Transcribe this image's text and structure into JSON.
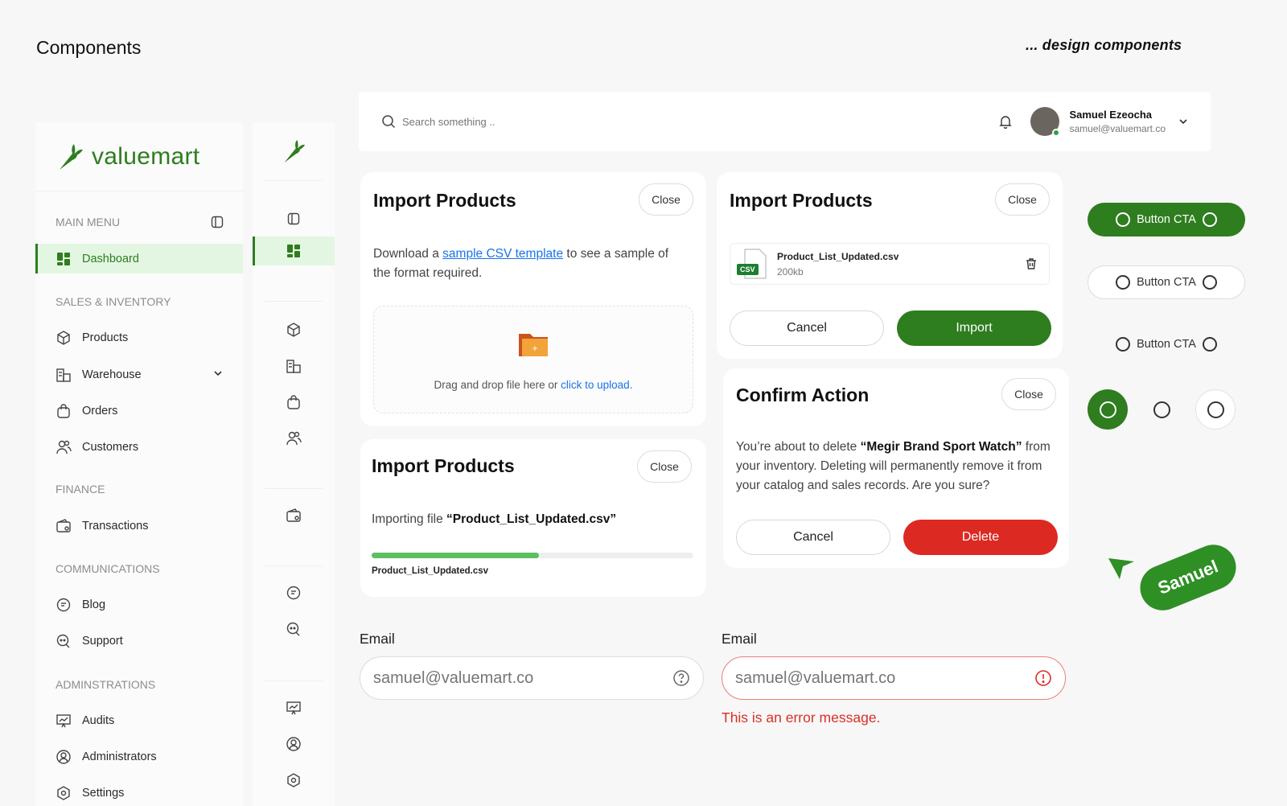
{
  "page": {
    "title": "Components",
    "tagline": "... design components"
  },
  "brand": {
    "name": "valuemart",
    "accent": "#2e7d1e",
    "danger": "#dc2a22"
  },
  "sidebar": {
    "sections": [
      {
        "label": "MAIN MENU"
      },
      {
        "label": "SALES & INVENTORY"
      },
      {
        "label": "FINANCE"
      },
      {
        "label": "COMMUNICATIONS"
      },
      {
        "label": "ADMINSTRATIONS"
      }
    ],
    "items": {
      "dashboard": "Dashboard",
      "products": "Products",
      "warehouse": "Warehouse",
      "orders": "Orders",
      "customers": "Customers",
      "transactions": "Transactions",
      "blog": "Blog",
      "support": "Support",
      "audits": "Audits",
      "administrators": "Administrators",
      "settings": "Settings"
    }
  },
  "topbar": {
    "search_placeholder": "Search something ..",
    "user_name": "Samuel Ezeocha",
    "user_email": "samuel@valuemart.co"
  },
  "import_card_1": {
    "title": "Import Products",
    "close": "Close",
    "text_before": "Download a ",
    "link": "sample CSV template",
    "text_after": " to see a sample of the format required.",
    "drop_text": "Drag and drop file here or ",
    "drop_link": "click to upload."
  },
  "import_card_2": {
    "title": "Import Products",
    "close": "Close",
    "file_badge": "CSV",
    "file_name": "Product_List_Updated.csv",
    "file_size": "200kb",
    "cancel": "Cancel",
    "import": "Import"
  },
  "import_card_3": {
    "title": "Import Products",
    "close": "Close",
    "prefix": "Importing file ",
    "file_quoted": "“Product_List_Updated.csv”",
    "progress": 0.52,
    "file_name": "Product_List_Updated.csv"
  },
  "confirm": {
    "title": "Confirm Action",
    "close": "Close",
    "text_before": "You’re about to delete ",
    "item": "“Megir Brand Sport Watch”",
    "text_after": " from your inventory. Deleting will permanently remove it from your catalog and sales records. Are you sure?",
    "cancel": "Cancel",
    "delete": "Delete"
  },
  "cta": {
    "label": "Button CTA"
  },
  "cursor_tag": "Samuel",
  "email_field": {
    "label": "Email",
    "placeholder": "samuel@valuemart.co"
  },
  "email_field_error": {
    "label": "Email",
    "placeholder": "samuel@valuemart.co",
    "error": "This is an error message."
  }
}
